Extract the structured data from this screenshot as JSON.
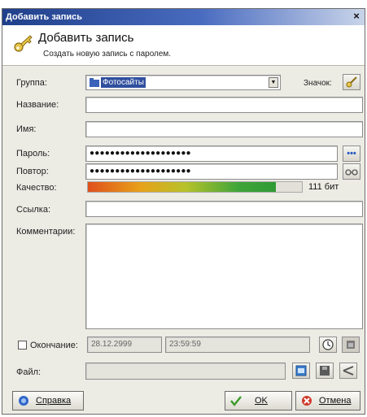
{
  "window": {
    "title": "Добавить запись",
    "close_glyph": "×"
  },
  "header": {
    "title": "Добавить запись",
    "subtitle": "Создать новую запись с паролем.",
    "icon": "key-icon"
  },
  "form": {
    "group_label": "Группа:",
    "group_value": "Фотосайты",
    "icon_label": "Значок:",
    "title_label": "Название:",
    "title_value": "",
    "user_label": "Имя:",
    "user_value": "",
    "password_label": "Пароль:",
    "password_value": "●●●●●●●●●●●●●●●●●●●●",
    "repeat_label": "Повтор:",
    "repeat_value": "●●●●●●●●●●●●●●●●●●●●",
    "quality_label": "Качество:",
    "quality_fraction": 0.88,
    "quality_text": "111 бит",
    "url_label": "Ссылка:",
    "url_value": "",
    "comment_label": "Комментарии:",
    "comment_value": "",
    "expires_label": "Окончание:",
    "expires_date": "28.12.2999",
    "expires_time": "23:59:59",
    "file_label": "Файл:",
    "file_value": ""
  },
  "buttons": {
    "help": "Справка",
    "ok": "OK",
    "cancel": "Отмена"
  },
  "colors": {
    "title_bar": "#1f3f8a",
    "quality_low": "#e0501c",
    "quality_high": "#2f9a35"
  }
}
